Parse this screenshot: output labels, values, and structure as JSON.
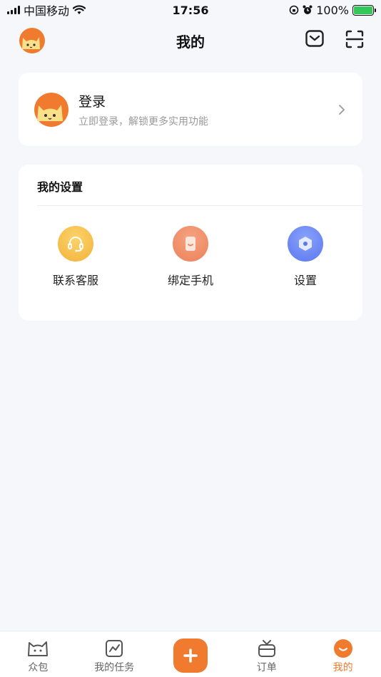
{
  "status_bar": {
    "carrier": "中国移动",
    "time": "17:56",
    "battery": "100%"
  },
  "header": {
    "title": "我的"
  },
  "login": {
    "title": "登录",
    "subtitle": "立即登录，解锁更多实用功能"
  },
  "settings": {
    "title": "我的设置",
    "items": [
      {
        "label": "联系客服",
        "icon": "headset-icon",
        "color": "#f6bf4d"
      },
      {
        "label": "绑定手机",
        "icon": "phone-icon",
        "color": "#f08c6a"
      },
      {
        "label": "设置",
        "icon": "hexagon-settings-icon",
        "color": "#6b87f5"
      }
    ]
  },
  "tabbar": {
    "tabs": [
      {
        "label": "众包",
        "icon": "cat-outline-icon"
      },
      {
        "label": "我的任务",
        "icon": "chart-icon"
      },
      {
        "label": "",
        "icon": "plus-icon"
      },
      {
        "label": "订单",
        "icon": "tv-box-icon"
      },
      {
        "label": "我的",
        "icon": "smile-circle-icon",
        "active": true
      }
    ],
    "accent": "#f07b2f"
  }
}
